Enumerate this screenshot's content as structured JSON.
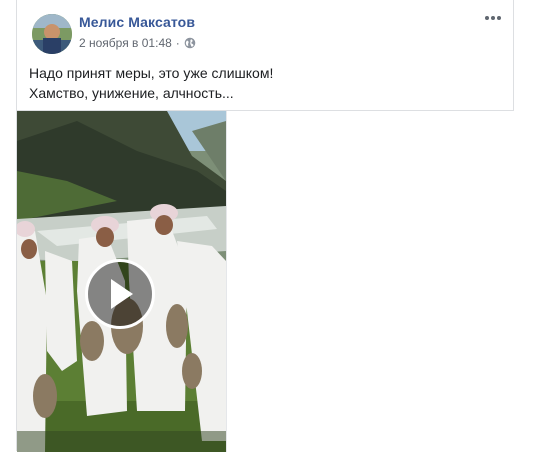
{
  "post": {
    "author": "Мелис Максатов",
    "date": "2 ноября в 01:48",
    "separator": "·",
    "privacy_icon": "globe-icon",
    "more_icon": "more-options-icon",
    "text_lines": [
      "Надо принят меры, это уже слишком!",
      "Хамство, унижение, алчность..."
    ]
  },
  "video": {
    "play_icon": "play-icon"
  },
  "colors": {
    "author_link": "#385898",
    "meta_text": "#616770",
    "body_text": "#1c1e21",
    "border": "#dddfe2"
  }
}
